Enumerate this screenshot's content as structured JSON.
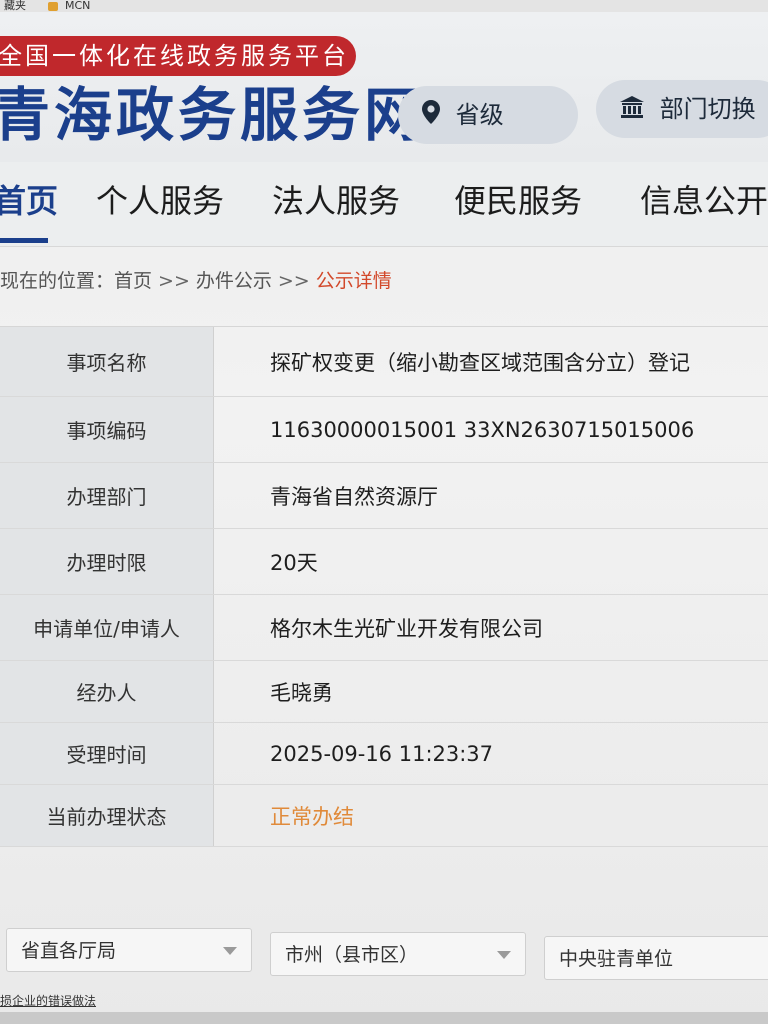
{
  "bookmarks": {
    "items": [
      {
        "label": "藏夹"
      },
      {
        "label": "MCN"
      }
    ]
  },
  "header": {
    "slogan": "全国一体化在线政务服务平台",
    "site_title": "青海政务服务网",
    "region_label": "省级",
    "dept_switch_label": "部门切换"
  },
  "nav": {
    "items": [
      {
        "label": "首页"
      },
      {
        "label": "个人服务"
      },
      {
        "label": "法人服务"
      },
      {
        "label": "便民服务"
      },
      {
        "label": "信息公开"
      }
    ]
  },
  "breadcrumb": {
    "prefix": "现在的位置：",
    "items": [
      "首页",
      "办件公示"
    ],
    "separator": ">>",
    "current": "公示详情"
  },
  "detail": {
    "rows": [
      {
        "label": "事项名称",
        "value": "探矿权变更（缩小勘查区域范围含分立）登记"
      },
      {
        "label": "事项编码",
        "value": "11630000015001 33XN2630715015006"
      },
      {
        "label": "办理部门",
        "value": "青海省自然资源厅"
      },
      {
        "label": "办理时限",
        "value": "20天"
      },
      {
        "label": "申请单位/申请人",
        "value": "格尔木生光矿业开发有限公司"
      },
      {
        "label": "经办人",
        "value": "毛晓勇"
      },
      {
        "label": "受理时间",
        "value": "2025-09-16 11:23:37"
      },
      {
        "label": "当前办理状态",
        "value": "正常办结"
      }
    ]
  },
  "filters": {
    "provincial": "省直各厅局",
    "city": "市州（县市区）",
    "central": "中央驻青单位"
  },
  "footer": {
    "link": "损企业的错误做法"
  },
  "colors": {
    "brand_blue": "#1b3f8c",
    "slogan_red": "#c0282c",
    "status_orange": "#e08a3a",
    "breadcrumb_current": "#d2482a"
  }
}
